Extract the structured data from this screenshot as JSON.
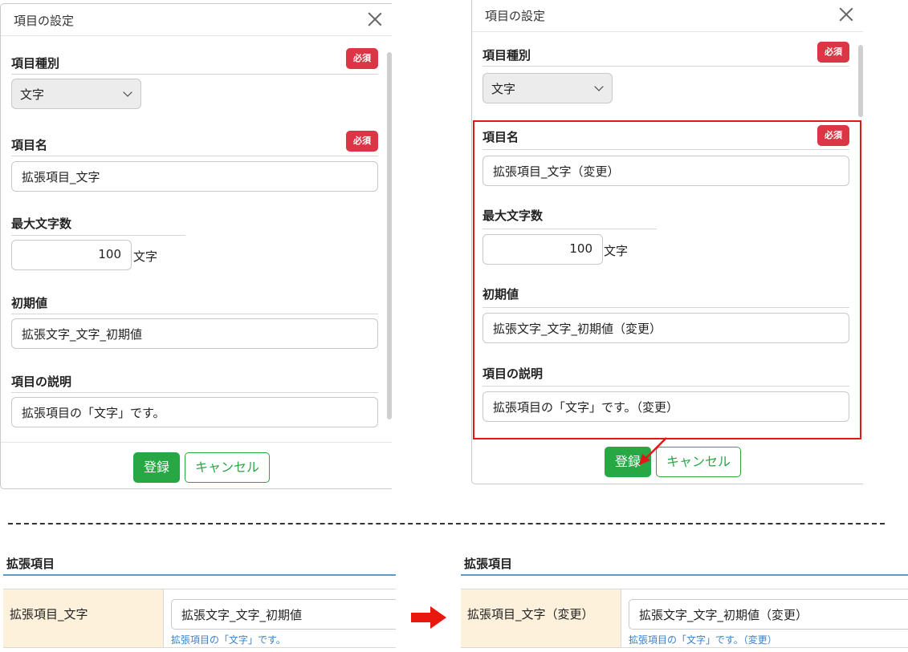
{
  "before_dialog": {
    "title": "項目の設定",
    "type_section": {
      "label": "項目種別",
      "required_badge": "必須",
      "selected": "文字"
    },
    "name_section": {
      "label": "項目名",
      "required_badge": "必須",
      "value": "拡張項目_文字"
    },
    "maxlen_section": {
      "label": "最大文字数",
      "value": "100",
      "unit": "文字"
    },
    "default_section": {
      "label": "初期値",
      "value": "拡張文字_文字_初期値"
    },
    "desc_section": {
      "label": "項目の説明",
      "value": "拡張項目の「文字」です。"
    },
    "register_label": "登録",
    "cancel_label": "キャンセル"
  },
  "after_dialog": {
    "title": "項目の設定",
    "type_section": {
      "label": "項目種別",
      "required_badge": "必須",
      "selected": "文字"
    },
    "name_section": {
      "label": "項目名",
      "required_badge": "必須",
      "value": "拡張項目_文字（変更）"
    },
    "maxlen_section": {
      "label": "最大文字数",
      "value": "100",
      "unit": "文字"
    },
    "default_section": {
      "label": "初期値",
      "value": "拡張文字_文字_初期値（変更）"
    },
    "desc_section": {
      "label": "項目の説明",
      "value": "拡張項目の「文字」です。（変更）"
    },
    "register_label": "登録",
    "cancel_label": "キャンセル"
  },
  "before_result": {
    "section_title": "拡張項目",
    "field_label": "拡張項目_文字",
    "field_value": "拡張文字_文字_初期値",
    "help_text": "拡張項目の「文字」です。"
  },
  "after_result": {
    "section_title": "拡張項目",
    "field_label": "拡張項目_文字（変更）",
    "field_value": "拡張文字_文字_初期値（変更）",
    "help_text": "拡張項目の「文字」です。（変更）"
  },
  "colors": {
    "required_badge": "#dc3545",
    "primary_button": "#28a745",
    "highlight": "#e01818",
    "label_cell": "#fdf1dc",
    "help_text": "#3d80c4"
  },
  "icons": {
    "close": "close-icon",
    "select": "chevron-down-icon",
    "transition": "right-arrow-icon"
  }
}
